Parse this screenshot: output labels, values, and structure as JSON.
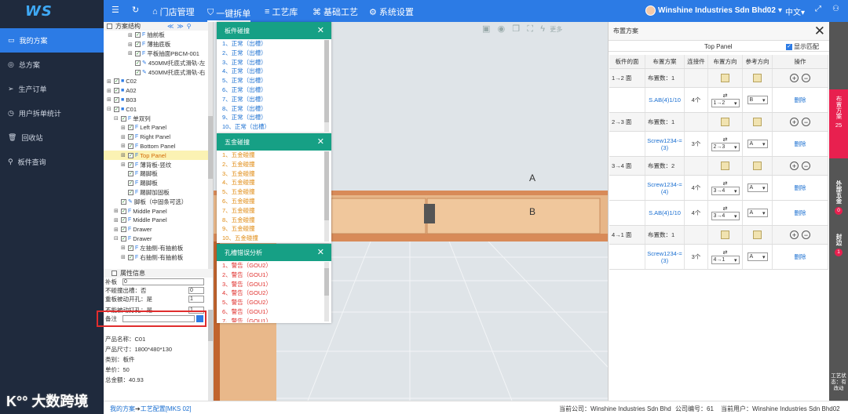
{
  "header": {
    "logo": "WS",
    "nav": [
      {
        "label": "门店管理",
        "icon": "house-icon"
      },
      {
        "label": "一键拆单",
        "icon": "shield-icon"
      },
      {
        "label": "工艺库",
        "icon": "list-icon"
      },
      {
        "label": "基础工艺",
        "icon": "gamepad-icon"
      },
      {
        "label": "系统设置",
        "icon": "gear-icon"
      }
    ],
    "active_nav": 1,
    "company": "Winshine Industries Sdn Bhd02",
    "language": "中文"
  },
  "sidebar": {
    "items": [
      {
        "label": "我的方案",
        "active": true
      },
      {
        "label": "总方案"
      },
      {
        "label": "生产订单"
      },
      {
        "label": "用户拆单统计"
      },
      {
        "label": "回收站"
      },
      {
        "label": "板件查询"
      }
    ]
  },
  "tree": {
    "title": "方案结构",
    "rows": [
      {
        "indent": 3,
        "pm": "⊞",
        "check": true,
        "icon": "F",
        "label": "抽前板"
      },
      {
        "indent": 3,
        "pm": "⊞",
        "check": true,
        "icon": "F",
        "label": "薄抽底板"
      },
      {
        "indent": 3,
        "pm": "⊞",
        "check": true,
        "icon": "F",
        "label": "平板抽面PBCM-001"
      },
      {
        "indent": 3,
        "pm": "",
        "check": true,
        "icon": "✎",
        "label": "450MM托底式滑轨-左"
      },
      {
        "indent": 3,
        "pm": "",
        "check": true,
        "icon": "✎",
        "label": "450MM托底式滑轨-右"
      },
      {
        "indent": 0,
        "pm": "⊞",
        "check": true,
        "icon": "■",
        "label": "C02"
      },
      {
        "indent": 0,
        "pm": "⊞",
        "check": true,
        "icon": "■",
        "label": "A02"
      },
      {
        "indent": 0,
        "pm": "⊞",
        "check": true,
        "icon": "■",
        "label": "B03"
      },
      {
        "indent": 0,
        "pm": "⊟",
        "check": true,
        "icon": "■",
        "label": "C01"
      },
      {
        "indent": 1,
        "pm": "⊟",
        "check": true,
        "icon": "F",
        "label": "单双列"
      },
      {
        "indent": 2,
        "pm": "⊞",
        "check": true,
        "icon": "F",
        "label": "Left Panel"
      },
      {
        "indent": 2,
        "pm": "⊞",
        "check": true,
        "icon": "F",
        "label": "Right Panel"
      },
      {
        "indent": 2,
        "pm": "⊞",
        "check": true,
        "icon": "F",
        "label": "Bottom Panel"
      },
      {
        "indent": 2,
        "pm": "⊞",
        "check": true,
        "icon": "F",
        "label": "Top Panel",
        "highlight": true
      },
      {
        "indent": 2,
        "pm": "⊞",
        "check": true,
        "icon": "F",
        "label": "薄背板-竖纹"
      },
      {
        "indent": 2,
        "pm": "",
        "check": true,
        "icon": "F",
        "label": "踢脚板"
      },
      {
        "indent": 2,
        "pm": "",
        "check": true,
        "icon": "F",
        "label": "踢脚板"
      },
      {
        "indent": 2,
        "pm": "",
        "check": true,
        "icon": "F",
        "label": "踢脚加固板"
      },
      {
        "indent": 1,
        "pm": "",
        "check": true,
        "icon": "✎",
        "label": "脚板（中固条可选）"
      },
      {
        "indent": 1,
        "pm": "⊞",
        "check": true,
        "icon": "F",
        "label": "Middle Panel"
      },
      {
        "indent": 1,
        "pm": "⊞",
        "check": true,
        "icon": "F",
        "label": "Middle Panel"
      },
      {
        "indent": 1,
        "pm": "⊞",
        "check": true,
        "icon": "F",
        "label": "Drawer"
      },
      {
        "indent": 1,
        "pm": "⊟",
        "check": true,
        "icon": "F",
        "label": "Drawer"
      },
      {
        "indent": 2,
        "pm": "⊞",
        "check": true,
        "icon": "F",
        "label": "左抽侧-有抽前板"
      },
      {
        "indent": 2,
        "pm": "⊞",
        "check": true,
        "icon": "F",
        "label": "右抽侧-有抽前板"
      }
    ]
  },
  "attributes": {
    "title": "属性信息",
    "rows": [
      {
        "label": "补板",
        "value": "0"
      },
      {
        "label": "不碰撞出槽：否",
        "value": "0"
      },
      {
        "label": "重板被动开孔：是",
        "value": "1"
      },
      {
        "label": "不能被动打孔：是",
        "value": "1"
      },
      {
        "label": "备注",
        "value": ""
      }
    ],
    "info": [
      "产品名称：C01",
      "产品尺寸：1800*480*130",
      "类别：板件",
      "单价：50",
      "总金额：40.93"
    ]
  },
  "dialogs": [
    {
      "title": "板件碰撞",
      "color": "#1a6fd1",
      "items": [
        "1、正常（出槽）",
        "2、正常（出槽）",
        "3、正常（出槽）",
        "4、正常（出槽）",
        "5、正常（出槽）",
        "6、正常（出槽）",
        "7、正常（出槽）",
        "8、正常（出槽）",
        "9、正常（出槽）",
        "10、正常（出槽）"
      ]
    },
    {
      "title": "五金碰撞",
      "color": "#e08a10",
      "items": [
        "1、五金碰撞",
        "2、五金碰撞",
        "3、五金碰撞",
        "4、五金碰撞",
        "5、五金碰撞",
        "6、五金碰撞",
        "7、五金碰撞",
        "8、五金碰撞",
        "9、五金碰撞",
        "10、五金碰撞"
      ]
    },
    {
      "title": "孔槽错误分析",
      "color": "#e0302d",
      "items": [
        "1、警告（GOU2）",
        "2、警告（GOU1）",
        "3、警告（GOU1）",
        "4、警告（GOU2）",
        "5、警告（GOU2）",
        "6、警告（GOU1）",
        "7、警告（GOU1）"
      ]
    }
  ],
  "viewport": {
    "label_a": "A",
    "label_b": "B",
    "toolbar_more": "更多"
  },
  "panel": {
    "title": "布置方案",
    "subtitle": "Top Panel",
    "show_match": "显示匹配",
    "columns": [
      "板件的面",
      "布置方案",
      "连接件",
      "布置方向",
      "参考方向",
      "操作"
    ],
    "groups": [
      {
        "face": "1→2 面",
        "count": "布置数：1",
        "rows": [
          {
            "scheme": "S.AB(4)1/10",
            "qty": "4个",
            "dir": "1→2",
            "ref": "B",
            "action": "删除"
          }
        ]
      },
      {
        "face": "2→3 面",
        "count": "布置数：1",
        "rows": [
          {
            "scheme": "Screw1234-=(3)",
            "qty": "3个",
            "dir": "2→3",
            "ref": "A",
            "action": "删除"
          }
        ]
      },
      {
        "face": "3→4 面",
        "count": "布置数：2",
        "rows": [
          {
            "scheme": "Screw1234-=(4)",
            "qty": "4个",
            "dir": "3→4",
            "ref": "A",
            "action": "删除"
          },
          {
            "scheme": "S.AB(4)1/10",
            "qty": "4个",
            "dir": "3→4",
            "ref": "A",
            "action": "删除"
          }
        ]
      },
      {
        "face": "4→1 面",
        "count": "布置数：1",
        "rows": [
          {
            "scheme": "Screw1234-=(3)",
            "qty": "3个",
            "dir": "4→1",
            "ref": "A",
            "action": "删除"
          }
        ]
      }
    ]
  },
  "right_tabs": [
    {
      "label": "布置方案",
      "badge": "25",
      "active": true
    },
    {
      "label": "外部五金",
      "badge": "0"
    },
    {
      "label": "封边",
      "badge": "1"
    }
  ],
  "right_status": "工艺状态：有改动",
  "status": {
    "breadcrumb_1": "我的方案",
    "breadcrumb_2": "工艺配置[MKS 02]",
    "company": "当前公司：Winshine Industries Sdn Bhd",
    "code": "公司编号：61",
    "user": "当前用户：Winshine Industries Sdn Bhd02"
  },
  "watermark": "大数跨境"
}
